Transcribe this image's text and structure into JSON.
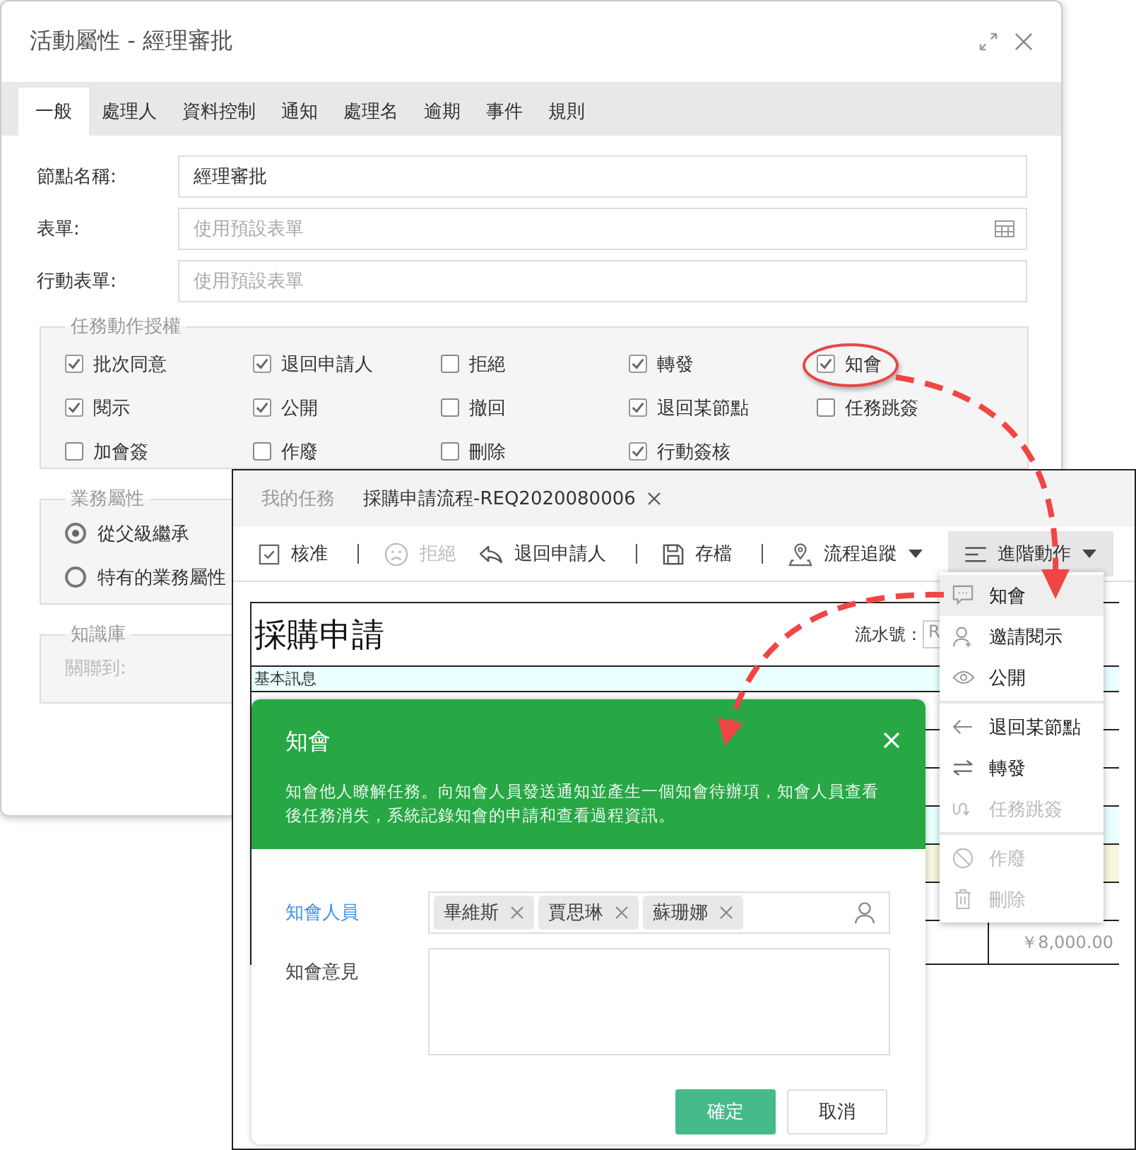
{
  "property_dialog": {
    "title": "活動屬性 - 經理審批",
    "tabs": [
      {
        "label": "一般",
        "selected": true
      },
      {
        "label": "處理人",
        "selected": false
      },
      {
        "label": "資料控制",
        "selected": false
      },
      {
        "label": "通知",
        "selected": false
      },
      {
        "label": "處理名",
        "selected": false
      },
      {
        "label": "逾期",
        "selected": false
      },
      {
        "label": "事件",
        "selected": false
      },
      {
        "label": "規則",
        "selected": false
      }
    ],
    "fields": [
      {
        "label": "節點名稱:",
        "value": "經理審批",
        "has_picker": false
      },
      {
        "label": "表單:",
        "placeholder": "使用預設表單",
        "has_picker": true
      },
      {
        "label": "行動表單:",
        "placeholder": "使用預設表單",
        "has_picker": false
      }
    ],
    "permissions": {
      "legend": "任務動作授權",
      "items": [
        {
          "label": "批次同意",
          "checked": true,
          "circled": false
        },
        {
          "label": "退回申請人",
          "checked": true,
          "circled": false
        },
        {
          "label": "拒絕",
          "checked": false,
          "circled": false
        },
        {
          "label": "轉發",
          "checked": true,
          "circled": false
        },
        {
          "label": "知會",
          "checked": true,
          "circled": true
        },
        {
          "label": "閱示",
          "checked": true,
          "circled": false
        },
        {
          "label": "公開",
          "checked": true,
          "circled": false
        },
        {
          "label": "撤回",
          "checked": false,
          "circled": false
        },
        {
          "label": "退回某節點",
          "checked": true,
          "circled": false
        },
        {
          "label": "任務跳簽",
          "checked": false,
          "circled": false
        },
        {
          "label": "加會簽",
          "checked": false,
          "circled": false
        },
        {
          "label": "作廢",
          "checked": false,
          "circled": false
        },
        {
          "label": "刪除",
          "checked": false,
          "circled": false
        },
        {
          "label": "行動簽核",
          "checked": true,
          "circled": false
        }
      ]
    },
    "business": {
      "legend": "業務屬性",
      "options": [
        {
          "label": "從父級繼承",
          "selected": true
        },
        {
          "label": "特有的業務屬性",
          "selected": false
        }
      ]
    },
    "knowledge": {
      "legend": "知識庫",
      "label": "關聯到:"
    }
  },
  "task_window": {
    "tabs": [
      {
        "label": "我的任務",
        "selected": false,
        "closable": false
      },
      {
        "label": "採購申請流程-REQ2020080006",
        "selected": true,
        "closable": true
      }
    ],
    "toolbar": [
      {
        "label": "核准",
        "disabled": false,
        "separator_after": true,
        "dropdown": false,
        "pressed": false
      },
      {
        "label": "拒絕",
        "disabled": true,
        "separator_after": false,
        "dropdown": false,
        "pressed": false
      },
      {
        "label": "退回申請人",
        "disabled": false,
        "separator_after": true,
        "dropdown": false,
        "pressed": false
      },
      {
        "label": "存檔",
        "disabled": false,
        "separator_after": true,
        "dropdown": false,
        "pressed": false
      },
      {
        "label": "流程追蹤",
        "disabled": false,
        "separator_after": false,
        "dropdown": true,
        "pressed": false
      },
      {
        "label": "進階動作",
        "disabled": false,
        "separator_after": false,
        "dropdown": true,
        "pressed": true
      }
    ],
    "form": {
      "title": "採購申請",
      "serial_label": "流水號：",
      "serial_value": "R",
      "section": "基本訊息",
      "amount": "￥8,000.00"
    }
  },
  "action_menu": {
    "items": [
      {
        "label": "知會",
        "selected": true,
        "disabled": false,
        "divider_before": false
      },
      {
        "label": "邀請閱示",
        "selected": false,
        "disabled": false,
        "divider_before": false
      },
      {
        "label": "公開",
        "selected": false,
        "disabled": false,
        "divider_before": false
      },
      {
        "label": "退回某節點",
        "selected": false,
        "disabled": false,
        "divider_before": true
      },
      {
        "label": "轉發",
        "selected": false,
        "disabled": false,
        "divider_before": false
      },
      {
        "label": "任務跳簽",
        "selected": false,
        "disabled": true,
        "divider_before": false
      },
      {
        "label": "作廢",
        "selected": false,
        "disabled": true,
        "divider_before": true
      },
      {
        "label": "刪除",
        "selected": false,
        "disabled": true,
        "divider_before": false
      }
    ]
  },
  "cc_dialog": {
    "title": "知會",
    "description": "知會他人瞭解任務。向知會人員發送通知並產生一個知會待辦項，知會人員查看後任務消失，系統記錄知會的申請和查看過程資訊。",
    "recipients_label": "知會人員",
    "recipients": [
      "畢維斯",
      "賈思琳",
      "蘇珊娜"
    ],
    "opinion_label": "知會意見",
    "confirm": "確定",
    "cancel": "取消"
  }
}
